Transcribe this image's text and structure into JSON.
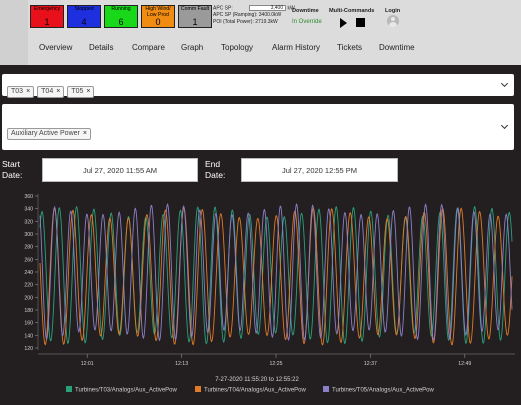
{
  "status_tiles": [
    {
      "label": "Emergency",
      "count": "1",
      "bg": "#e8101a",
      "fg": "#000000"
    },
    {
      "label": "Stopped",
      "count": "4",
      "bg": "#1e2fe0",
      "fg": "#000000"
    },
    {
      "label": "Running",
      "count": "6",
      "bg": "#19d819",
      "fg": "#000000"
    },
    {
      "label": "High Wind/ Low Prod",
      "count": "0",
      "bg": "#f08c12",
      "fg": "#000000"
    },
    {
      "label": "Comm Fault",
      "count": "1",
      "bg": "#9a9a9a",
      "fg": "#000000"
    }
  ],
  "apc": {
    "sp_label": "APC SP:",
    "sp_value": "3,400",
    "sp_unit": "kW",
    "ramping_text": "APC SP (Ramping): 3400.0kW",
    "poi_text": "POI (Total Power): 2719.3kW"
  },
  "downtime": {
    "title": "Downtime",
    "status": "In Override"
  },
  "multi_commands": {
    "title": "Multi-Commands"
  },
  "login": {
    "label": "Login"
  },
  "nav": [
    "Overview",
    "Details",
    "Compare",
    "Graph",
    "Topology",
    "Alarm History",
    "Tickets",
    "Downtime"
  ],
  "turbine_tags": [
    "T03",
    "T04",
    "T05"
  ],
  "measurement_tags": [
    "Auxiliary Active Power"
  ],
  "tag_remove_glyph": "×",
  "start": {
    "label_line1": "Start",
    "label_line2": "Date:",
    "value": "Jul 27, 2020 11:55 AM"
  },
  "end": {
    "label_line1": "End",
    "label_line2": "Date:",
    "value": "Jul 27, 2020 12:55 PM"
  },
  "chart_data": {
    "type": "line",
    "x_tick_labels": [
      "12:01",
      "12:13",
      "12:25",
      "12:37",
      "12:49"
    ],
    "x_range_text": "7-27-2020   11:55:20   to   12:55:22",
    "x_range_connector": "to",
    "ylim": [
      120,
      360
    ],
    "y_ticks": [
      120,
      140,
      160,
      180,
      200,
      220,
      240,
      260,
      280,
      300,
      320,
      340,
      360
    ],
    "grid": false,
    "legend_position": "bottom-center",
    "series": [
      {
        "name": "Turbines/T03/Analogs/Aux_ActivePow",
        "color": "#2aa07a",
        "period_min": 2.2,
        "phase_min": 0.3,
        "values_range": [
          130,
          340
        ]
      },
      {
        "name": "Turbines/T04/Analogs/Aux_ActivePow",
        "color": "#e07a26",
        "period_min": 2.35,
        "phase_min": 1.1,
        "values_range": [
          128,
          338
        ]
      },
      {
        "name": "Turbines/T05/Analogs/Aux_ActivePow",
        "color": "#8b80c8",
        "period_min": 2.05,
        "phase_min": 0.7,
        "values_range": [
          135,
          344
        ]
      }
    ]
  }
}
